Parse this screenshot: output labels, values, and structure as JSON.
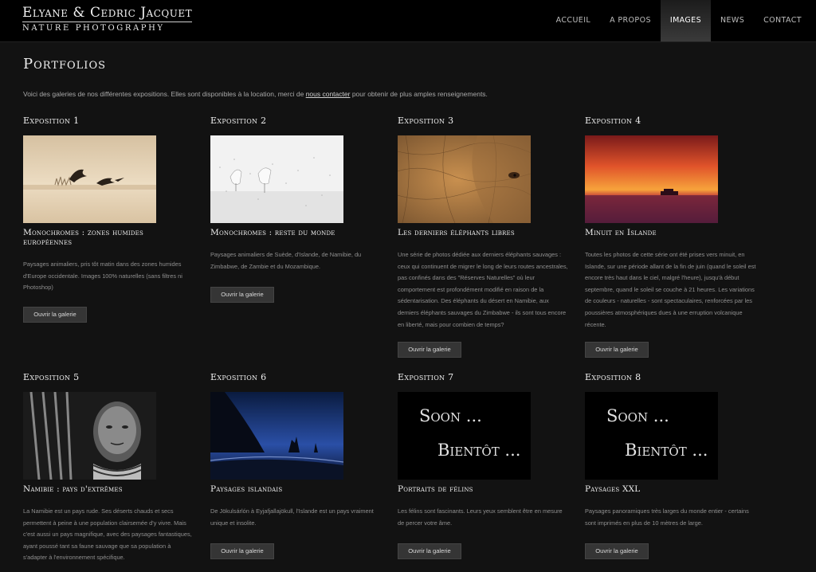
{
  "brand": {
    "name": "Elyane & Cedric Jacquet",
    "tagline": "NATURE PHOTOGRAPHY"
  },
  "nav": {
    "items": [
      "ACCUEIL",
      "A PROPOS",
      "IMAGES",
      "NEWS",
      "CONTACT"
    ],
    "active": "IMAGES"
  },
  "page": {
    "title": "Portfolios",
    "intro_before": "Voici des galeries de nos différentes expositions. Elles sont disponibles à la location, merci de ",
    "intro_link": "nous contacter",
    "intro_after": " pour obtenir de plus amples renseignements."
  },
  "button_label": "Ouvrir la galerie",
  "coming_soon": {
    "line1": "Soon ...",
    "line2": "Bientôt ..."
  },
  "exhibitions": [
    {
      "label": "Exposition 1",
      "title": "Monochromes : zones humides européennes",
      "description": "Paysages animaliers, pris tôt matin dans des zones humides d'Europe occidentale. Images 100% naturelles (sans filtres ni Photoshop)",
      "image": "geese-flying-over-misty-marsh"
    },
    {
      "label": "Exposition 2",
      "title": "Monochromes : reste du monde",
      "description": "Paysages animaliers de Suède, d'Islande, de Namibie, du Zimbabwe, de Zambie et du Mozambique.",
      "image": "swans-in-snow"
    },
    {
      "label": "Exposition 3",
      "title": "Les derniers éléphants libres",
      "description": "Une série de photos dédiée aux derniers éléphants sauvages : ceux qui continuent de migrer le long de leurs routes ancestrales, pas confinés dans des \"Réserves Naturelles\" où leur comportement est profondément modifié en raison de la sédentarisation. Des éléphants du désert en Namibie, aux derniers éléphants sauvages du Zimbabwe - ils sont tous encore en liberté, mais pour combien de temps?",
      "image": "elephant-skin-closeup"
    },
    {
      "label": "Exposition 4",
      "title": "Minuit en Islande",
      "description": "Toutes les photos de cette série ont été prises vers minuit, en Islande, sur une période allant de la fin de juin (quand le soleil est encore très haut dans le ciel, malgré l'heure), jusqu'à début septembre, quand le soleil se couche à 21 heures. Les variations de couleurs - naturelles - sont spectaculaires, renforcées par les poussières atmosphériques dues à une erruption volcanique récente.",
      "image": "red-sunset-over-sea"
    },
    {
      "label": "Exposition 5",
      "title": "Namibie : pays d'extrêmes",
      "description": "La Namibie est un pays rude. Ses déserts chauds et secs permettent à peine à une population clairsemée d'y vivre. Mais c'est aussi un pays magnifique, avec des paysages fantastiques, ayant poussé tant sa faune sauvage que sa population à s'adapter à l'environnement spécifique.",
      "image": "portrait-namibian-man-bw"
    },
    {
      "label": "Exposition 6",
      "title": "Paysages islandais",
      "description": "De Jökulsárlón à Eyjafjallajökull, l'Islande est un pays vraiment unique et insolite.",
      "image": "blue-coast-with-sea-stacks"
    },
    {
      "label": "Exposition 7",
      "title": "Portraits de félins",
      "description": "Les félins sont fascinants. Leurs yeux semblent être en mesure de percer votre âme.",
      "image": "coming-soon"
    },
    {
      "label": "Exposition 8",
      "title": "Paysages XXL",
      "description": "Paysages panoramiques très larges du monde entier - certains sont imprimés en plus de 10 mètres de large.",
      "image": "coming-soon"
    }
  ]
}
